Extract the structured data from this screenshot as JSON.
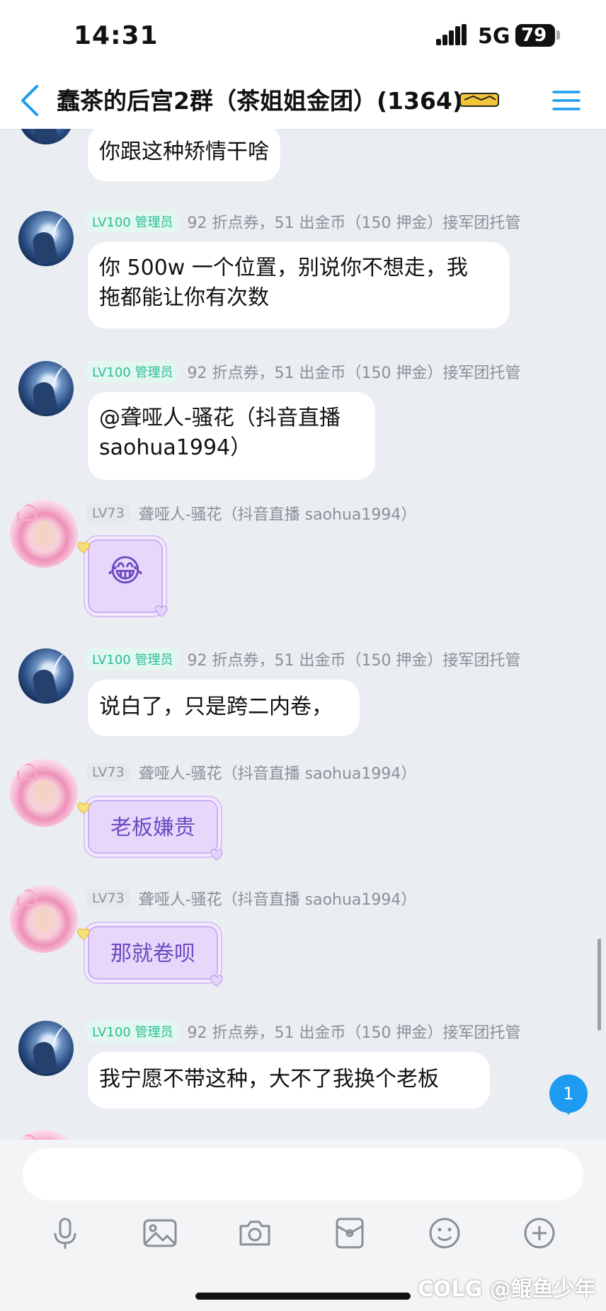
{
  "status_bar": {
    "time": "14:31",
    "network": "5G",
    "battery": "79"
  },
  "header": {
    "title": "蠢茶的后宫2群（茶姐姐金团）(1364)",
    "badge_icon": "sticker-icon",
    "menu_icon": "hamburger-menu-icon"
  },
  "admin_sender": {
    "level": "LV100",
    "role": "管理员",
    "name": "92 折点券，51 出金币（150 押金）接军团托管"
  },
  "member_sender": {
    "level": "LV73",
    "name": "聋哑人-骚花（抖音直播 saohua1994）"
  },
  "messages": [
    {
      "type": "text",
      "text": "你跟这种矫情干啥"
    },
    {
      "type": "text",
      "lines": [
        "你 500w 一个位置，别说你不想走，我",
        "拖都能让你有次数"
      ]
    },
    {
      "type": "text",
      "lines": [
        "@聋哑人-骚花（抖音直播",
        "saohua1994）"
      ]
    },
    {
      "type": "emoji",
      "text": "😂"
    },
    {
      "type": "text",
      "text": "说白了，只是跨二内卷，"
    },
    {
      "type": "bubble",
      "text": "老板嫌贵"
    },
    {
      "type": "bubble",
      "text": "那就卷呗"
    },
    {
      "type": "text",
      "text": "我宁愿不带这种，大不了我换个老板"
    }
  ],
  "unread_count": "1",
  "input": {
    "placeholder": ""
  },
  "toolbar": {
    "icons": [
      "microphone-icon",
      "image-icon",
      "camera-icon",
      "red-packet-icon",
      "emoji-icon",
      "plus-icon"
    ]
  },
  "watermark": "COLG @鲲鱼少年",
  "colors": {
    "accent": "#1d9bf0",
    "admin_badge": "#2cbd94",
    "bubble_purple": "#e7d8fb"
  }
}
